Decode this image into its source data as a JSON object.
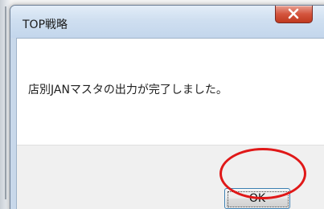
{
  "dialog": {
    "title": "TOP戦略",
    "close_icon": "close-x-icon",
    "message": "店別JANマスタの出力が完了しました。",
    "ok_label": "OK"
  },
  "annotation": {
    "highlight_color": "#e01818"
  }
}
